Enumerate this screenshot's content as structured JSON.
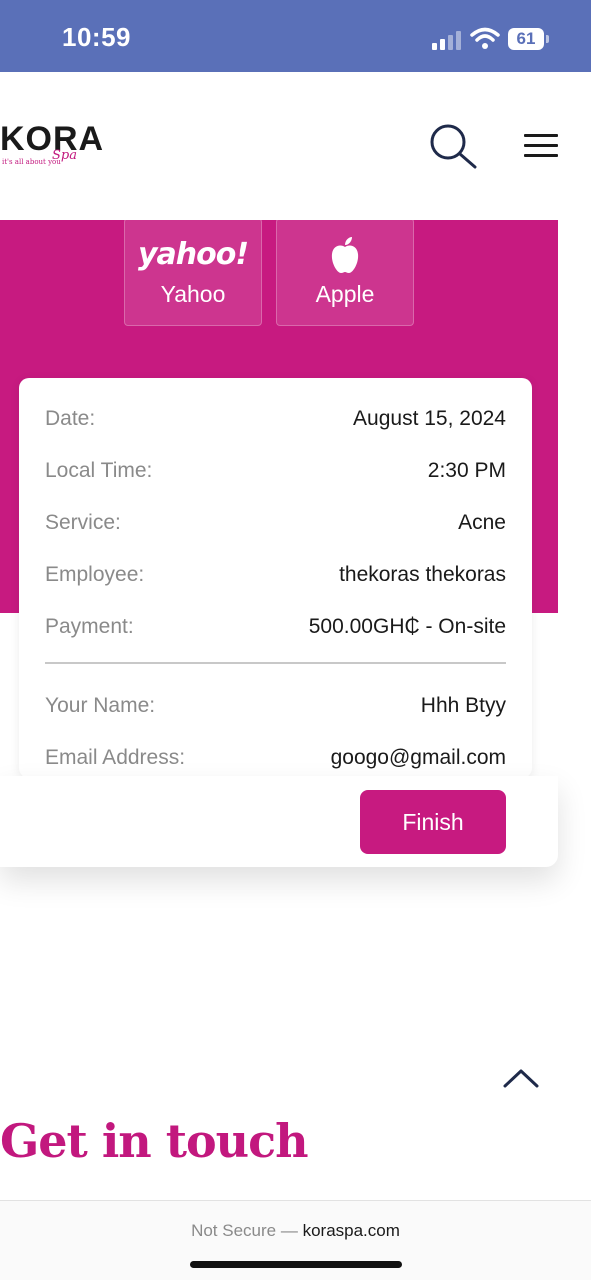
{
  "status_bar": {
    "time": "10:59",
    "battery": "61",
    "icons": [
      "signal-icon",
      "wifi-icon",
      "battery-icon"
    ]
  },
  "header": {
    "logo_text": "KORA",
    "logo_script": "Spa",
    "logo_tagline": "it's all about you",
    "icons": [
      "search-icon",
      "menu-icon"
    ]
  },
  "calendar_providers": [
    {
      "logo": "yahoo!",
      "label": "Yahoo"
    },
    {
      "logo": "apple-icon",
      "label": "Apple"
    }
  ],
  "summary": {
    "rows": [
      {
        "label": "Date:",
        "value": "August 15, 2024"
      },
      {
        "label": "Local Time:",
        "value": "2:30 PM"
      },
      {
        "label": "Service:",
        "value": "Acne"
      },
      {
        "label": "Employee:",
        "value": "thekoras thekoras"
      },
      {
        "label": "Payment:",
        "value": "500.00GH₵ - On-site"
      }
    ],
    "customer_rows": [
      {
        "label": "Your Name:",
        "value": "Hhh Btyy"
      },
      {
        "label": "Email Address:",
        "value": "googo@gmail.com"
      }
    ]
  },
  "actions": {
    "finish_label": "Finish"
  },
  "footer": {
    "heading": "Get in touch"
  },
  "browser": {
    "security": "Not Secure —",
    "domain": "koraspa.com"
  },
  "colors": {
    "brand_magenta": "#c71a80",
    "status_bar_bg": "#5a70b8",
    "label_gray": "#8a8a8a"
  }
}
